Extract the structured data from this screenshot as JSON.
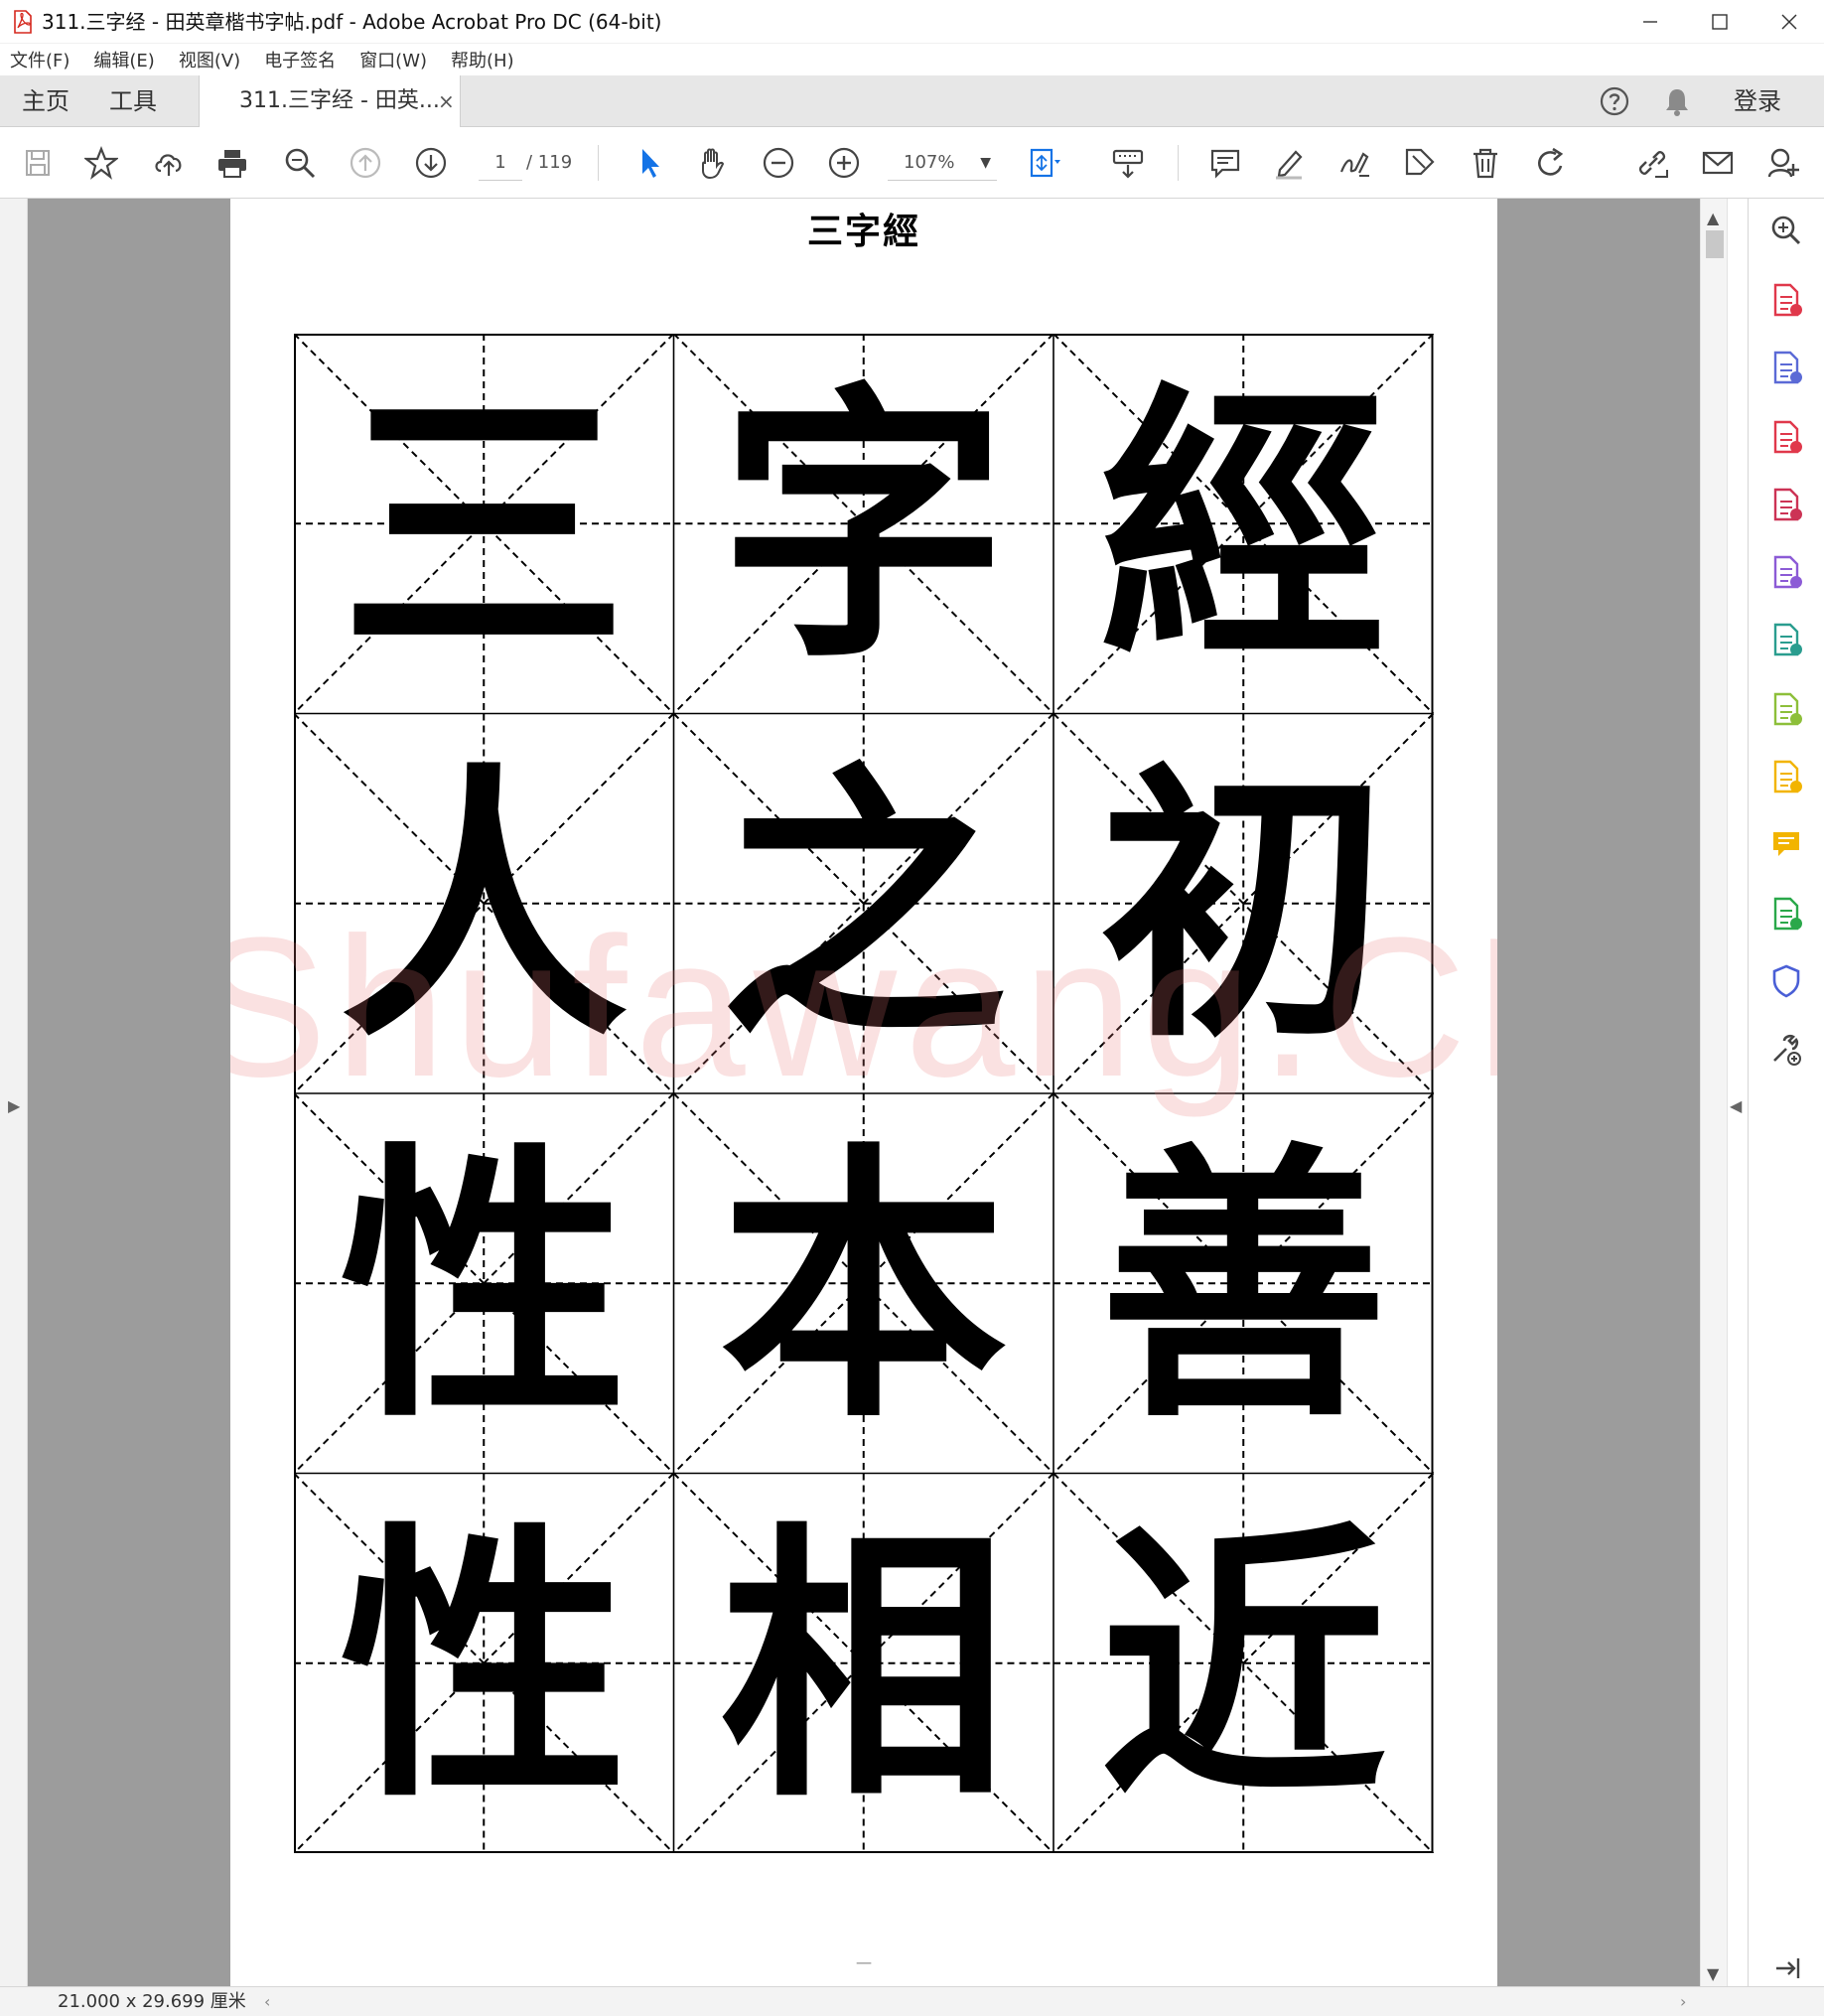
{
  "window": {
    "title": "311.三字经 - 田英章楷书字帖.pdf - Adobe Acrobat Pro DC (64-bit)",
    "app_icon": "acrobat-pdf-icon",
    "controls": [
      "minimize-icon",
      "maximize-icon",
      "close-icon"
    ]
  },
  "menu": {
    "items": [
      "文件(F)",
      "编辑(E)",
      "视图(V)",
      "电子签名",
      "窗口(W)",
      "帮助(H)"
    ]
  },
  "tabs": {
    "home": "主页",
    "tools": "工具",
    "document": "311.三字经 - 田英...",
    "close_symbol": "×",
    "login": "登录",
    "help_icon": "help-circle-icon",
    "notification_icon": "bell-icon"
  },
  "toolbar": {
    "current_page": "1",
    "total_pages": "/ 119",
    "zoom": "107%",
    "icons": [
      "save-icon",
      "bookmark-star-icon",
      "upload-cloud-icon",
      "print-icon",
      "search-zoom-icon",
      "page-up-icon",
      "page-down-icon",
      "select-arrow-icon",
      "hand-icon",
      "zoom-out-icon",
      "zoom-in-icon",
      "page-fit-icon",
      "keyboard-icon",
      "comment-icon",
      "highlight-icon",
      "sign-icon",
      "edit-stamp-icon",
      "delete-icon",
      "rotate-icon",
      "share-link-icon",
      "email-icon",
      "add-user-icon"
    ]
  },
  "document": {
    "page_title": "三字經",
    "characters": [
      "三",
      "字",
      "經",
      "人",
      "之",
      "初",
      "性",
      "本",
      "善",
      "性",
      "相",
      "近"
    ],
    "watermark": "Shufawang.CN",
    "footer": "一"
  },
  "sidebar": {
    "icons": [
      "zoom-search-icon",
      "create-pdf-icon",
      "export-pdf-icon",
      "organize-pages-icon",
      "edit-pdf-icon",
      "fill-sign-icon",
      "send-track-icon",
      "compare-icon",
      "edit-doc-icon",
      "comment-tool-icon",
      "scan-icon",
      "protect-icon",
      "more-tools-icon"
    ],
    "colors": [
      "#444444",
      "#e0384b",
      "#5b6ad6",
      "#e0384b",
      "#cc3355",
      "#8c5bd6",
      "#2a9d8f",
      "#8dbf3a",
      "#f2b400",
      "#f2b400",
      "#2aa84a",
      "#4a5fd6",
      "#444444"
    ]
  },
  "status": {
    "page_size": "21.000 x 29.699 厘米"
  },
  "colors": {
    "chrome_bg": "#e7e7e7",
    "canvas_gray": "#9c9c9c",
    "accent_blue": "#1473e6",
    "watermark": "#e87878"
  }
}
